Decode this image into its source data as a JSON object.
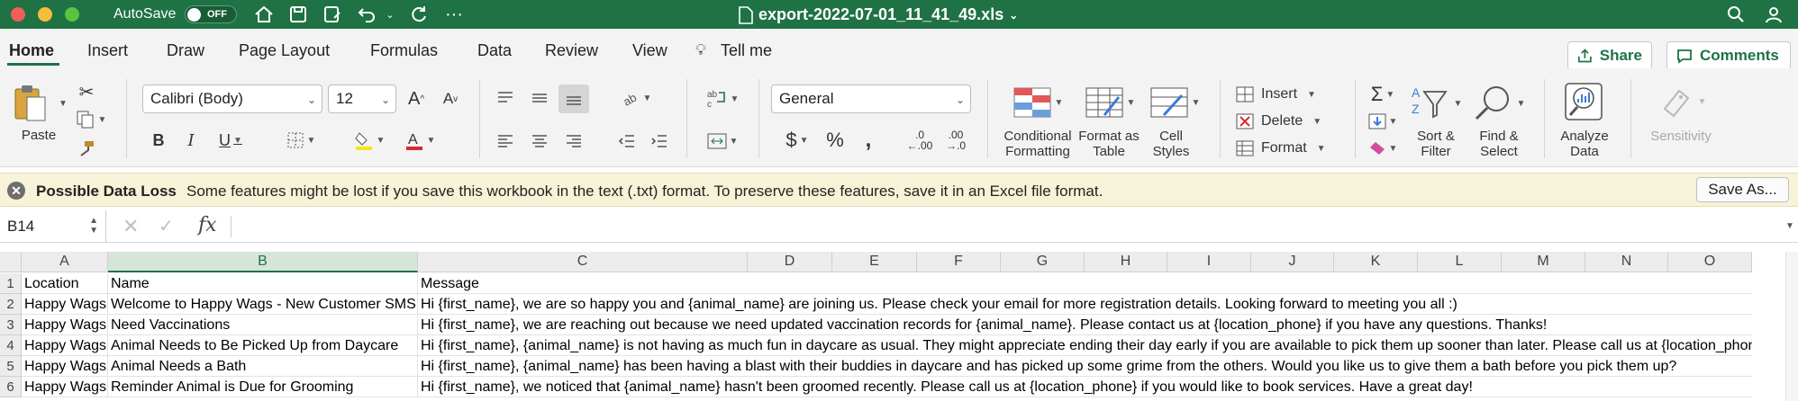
{
  "titlebar": {
    "autosave_label": "AutoSave",
    "autosave_state": "OFF",
    "document_title": "export-2022-07-01_11_41_49.xls"
  },
  "menu": {
    "items": [
      "Home",
      "Insert",
      "Draw",
      "Page Layout",
      "Formulas",
      "Data",
      "Review",
      "View",
      "Tell me"
    ],
    "share_label": "Share",
    "comments_label": "Comments"
  },
  "ribbon": {
    "paste_label": "Paste",
    "font_name": "Calibri (Body)",
    "font_size": "12",
    "number_format": "General",
    "conditional_formatting": "Conditional Formatting",
    "format_as_table": "Format as Table",
    "cell_styles": "Cell Styles",
    "insert_label": "Insert",
    "delete_label": "Delete",
    "format_label": "Format",
    "sort_filter": "Sort & Filter",
    "find_select": "Find & Select",
    "analyze_data": "Analyze Data",
    "sensitivity": "Sensitivity"
  },
  "message_bar": {
    "title": "Possible Data Loss",
    "text": "Some features might be lost if you save this workbook in the text (.txt) format. To preserve these features, save it in an Excel file format.",
    "button_label": "Save As..."
  },
  "formula_bar": {
    "name_box": "B14",
    "fx_label": "fx",
    "formula": ""
  },
  "sheet": {
    "selected_column": "B",
    "columns": [
      "A",
      "B",
      "C",
      "D",
      "E",
      "F",
      "G",
      "H",
      "I",
      "J",
      "K",
      "L",
      "M",
      "N",
      "O"
    ],
    "rows": [
      {
        "num": "1",
        "a": "Location",
        "b": "Name",
        "c": "Message"
      },
      {
        "num": "2",
        "a": "Happy Wags",
        "b": "Welcome to Happy Wags - New Customer SMS",
        "c": "Hi {first_name}, we are so happy you and {animal_name} are joining us. Please check your email for more registration details. Looking forward to meeting you all :)"
      },
      {
        "num": "3",
        "a": "Happy Wags",
        "b": "Need Vaccinations",
        "c": "Hi {first_name}, we are reaching out because we need updated vaccination records for {animal_name}. Please contact us at {location_phone} if you have any questions. Thanks!"
      },
      {
        "num": "4",
        "a": "Happy Wags",
        "b": "Animal Needs to Be Picked Up from Daycare",
        "c": "Hi {first_name}, {animal_name} is not having as much fun in daycare as usual. They might appreciate ending their day early if you are available to pick them up sooner than later. Please call us at {location_phone}"
      },
      {
        "num": "5",
        "a": "Happy Wags",
        "b": "Animal Needs a Bath",
        "c": "Hi {first_name}, {animal_name} has been having a blast with their buddies in daycare and has picked up some grime from the others. Would you like us to give them a bath before you pick them up?"
      },
      {
        "num": "6",
        "a": "Happy Wags",
        "b": "Reminder Animal is Due for Grooming",
        "c": "Hi {first_name}, we noticed that {animal_name} hasn't been groomed recently. Please call us at {location_phone} if you would like to book services. Have a great day!"
      }
    ]
  },
  "colors": {
    "excel_green": "#1f7244",
    "ribbon_bg": "#f3f3f3",
    "message_bg": "#f7f3d8"
  }
}
